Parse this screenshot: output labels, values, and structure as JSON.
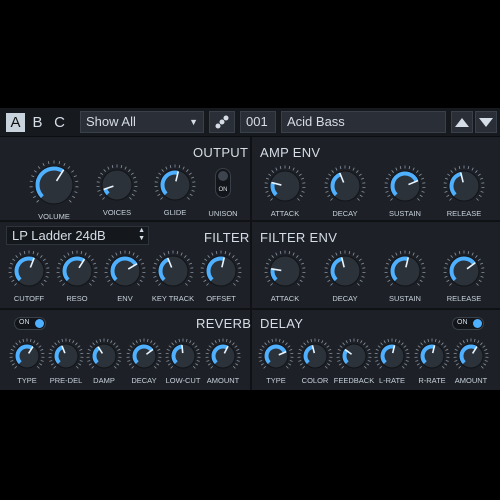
{
  "topbar": {
    "patch_slots": [
      "A",
      "B",
      "C"
    ],
    "selected_slot": "A",
    "category_value": "Show All",
    "preset_number": "001",
    "preset_name": "Acid Bass"
  },
  "output": {
    "title": "OUTPUT",
    "knobs": [
      {
        "label": "VOLUME",
        "value": 0.62
      },
      {
        "label": "VOICES",
        "value": 0.1
      },
      {
        "label": "GLIDE",
        "value": 0.55
      }
    ],
    "toggle": {
      "label": "UNISON",
      "state": "ON"
    }
  },
  "amp_env": {
    "title": "AMP ENV",
    "knobs": [
      {
        "label": "ATTACK",
        "value": 0.22
      },
      {
        "label": "DECAY",
        "value": 0.42
      },
      {
        "label": "SUSTAIN",
        "value": 0.75
      },
      {
        "label": "RELEASE",
        "value": 0.45
      }
    ]
  },
  "filter": {
    "title": "FILTER",
    "type_value": "LP Ladder 24dB",
    "knobs": [
      {
        "label": "CUTOFF",
        "value": 0.58
      },
      {
        "label": "RESO",
        "value": 0.62
      },
      {
        "label": "ENV",
        "value": 0.72
      },
      {
        "label": "KEY TRACK",
        "value": 0.42
      },
      {
        "label": "OFFSET",
        "value": 0.55
      }
    ]
  },
  "filter_env": {
    "title": "FILTER ENV",
    "knobs": [
      {
        "label": "ATTACK",
        "value": 0.2
      },
      {
        "label": "DECAY",
        "value": 0.45
      },
      {
        "label": "SUSTAIN",
        "value": 0.55
      },
      {
        "label": "RELEASE",
        "value": 0.7
      }
    ]
  },
  "reverb": {
    "title": "REVERB",
    "toggle": "ON",
    "knobs": [
      {
        "label": "TYPE",
        "value": 0.62
      },
      {
        "label": "PRE-DEL",
        "value": 0.42
      },
      {
        "label": "DAMP",
        "value": 0.38
      },
      {
        "label": "DECAY",
        "value": 0.7
      },
      {
        "label": "LOW-CUT",
        "value": 0.48
      },
      {
        "label": "AMOUNT",
        "value": 0.6
      }
    ]
  },
  "delay": {
    "title": "DELAY",
    "toggle": "ON",
    "knobs": [
      {
        "label": "TYPE",
        "value": 0.75
      },
      {
        "label": "COLOR",
        "value": 0.45
      },
      {
        "label": "FEEDBACK",
        "value": 0.3
      },
      {
        "label": "L-RATE",
        "value": 0.55
      },
      {
        "label": "R-RATE",
        "value": 0.55
      },
      {
        "label": "AMOUNT",
        "value": 0.62
      }
    ]
  },
  "colors": {
    "accent": "#4fb0ff",
    "panel": "#1d2127",
    "knob": "#2c323a",
    "tick": "#8a94a0"
  },
  "icons": {
    "category_caret": "chevron-down-icon",
    "shuffle": "shuffle-dots-icon",
    "prev": "triangle-up-icon",
    "next": "triangle-down-icon"
  }
}
